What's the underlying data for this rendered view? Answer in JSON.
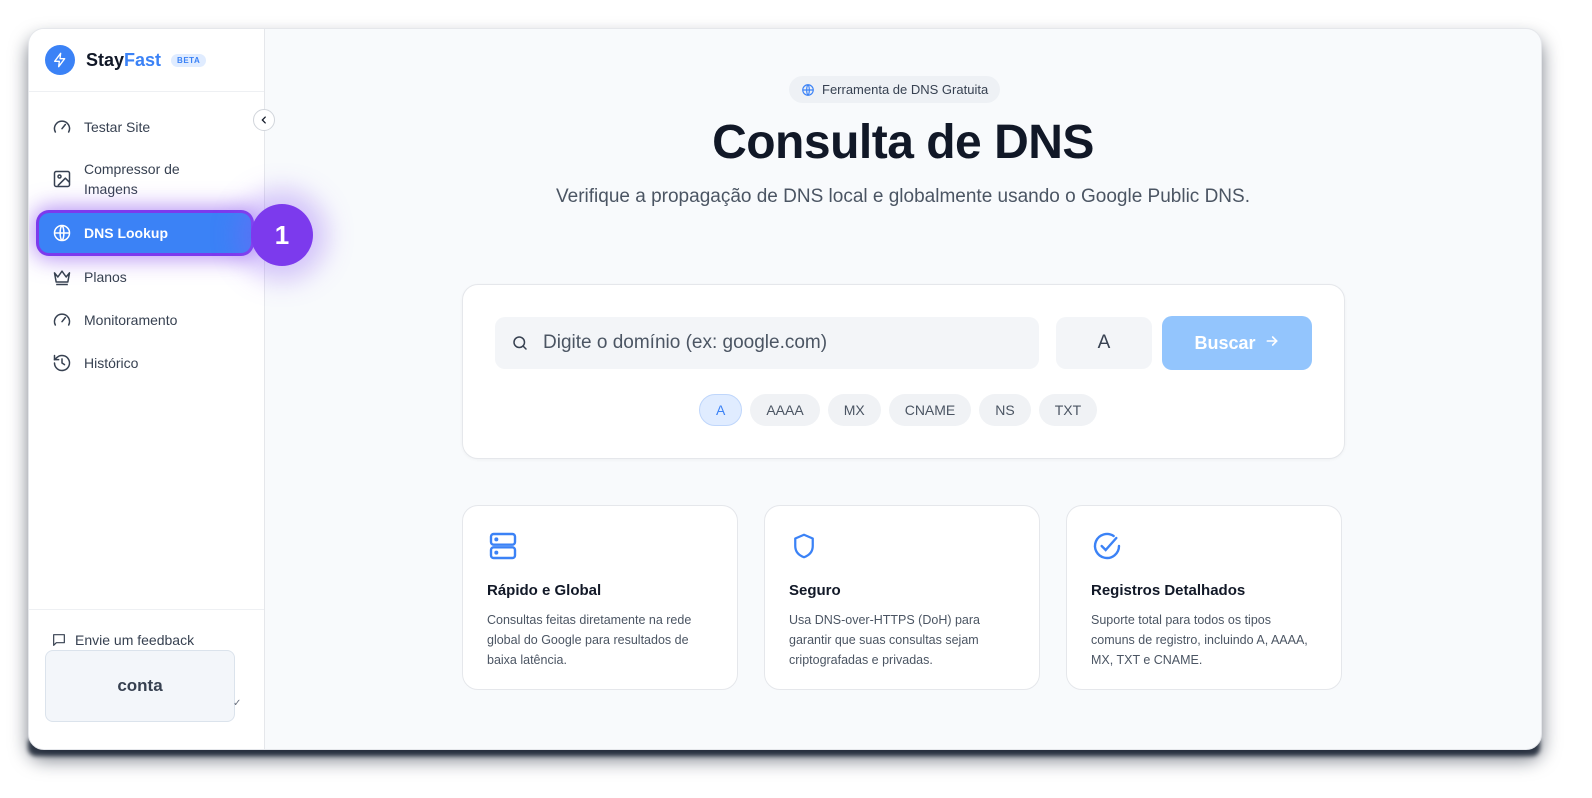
{
  "brand": {
    "name_part1": "Stay",
    "name_part2": "Fast",
    "badge": "BETA",
    "accent_color": "#3b82f6"
  },
  "sidebar": {
    "items": [
      {
        "label": "Testar Site",
        "icon": "gauge-icon"
      },
      {
        "label": "Compressor de Imagens",
        "icon": "image-icon"
      },
      {
        "label": "DNS Lookup",
        "icon": "globe-icon",
        "active": true
      },
      {
        "label": "Planos",
        "icon": "crown-icon"
      },
      {
        "label": "Monitoramento",
        "icon": "gauge-icon"
      },
      {
        "label": "Histórico",
        "icon": "history-icon"
      }
    ],
    "step_badge": "1",
    "feedback_label": "Envie um feedback",
    "account_label": "conta"
  },
  "main": {
    "pill_label": "Ferramenta de DNS Gratuita",
    "title": "Consulta de DNS",
    "subtitle": "Verifique a propagação de DNS local e globalmente usando o Google Public DNS.",
    "search": {
      "placeholder": "Digite o domínio (ex: google.com)",
      "value": "",
      "record_type": "A",
      "button_label": "Buscar",
      "button_color": "#93c5fd"
    },
    "chips": [
      "A",
      "AAAA",
      "MX",
      "CNAME",
      "NS",
      "TXT"
    ],
    "features": [
      {
        "title": "Rápido e Global",
        "desc": "Consultas feitas diretamente na rede global do Google para resultados de baixa latência.",
        "icon": "server-icon"
      },
      {
        "title": "Seguro",
        "desc": "Usa DNS-over-HTTPS (DoH) para garantir que suas consultas sejam criptografadas e privadas.",
        "icon": "shield-icon"
      },
      {
        "title": "Registros Detalhados",
        "desc": "Suporte total para todos os tipos comuns de registro, incluindo A, AAAA, MX, TXT e CNAME.",
        "icon": "check-circle-icon"
      }
    ]
  }
}
